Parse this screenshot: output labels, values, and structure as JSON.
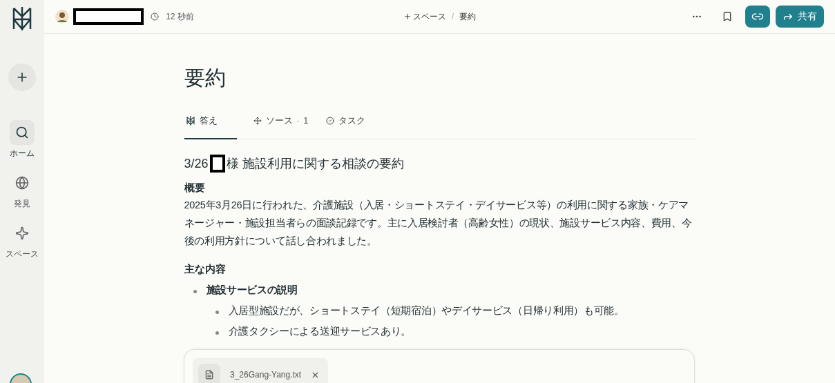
{
  "sidebar": {
    "items": [
      {
        "kind": "home",
        "label": "ホーム",
        "selected": true
      },
      {
        "kind": "discover",
        "label": "発見",
        "selected": false
      },
      {
        "kind": "spaces",
        "label": "スペース",
        "selected": false
      }
    ]
  },
  "topbar": {
    "time": "12 秒前",
    "space": "スペース",
    "separator": "/",
    "page": "要約",
    "share": "共有"
  },
  "page": {
    "title": "要約",
    "tabs": [
      {
        "kind": "answer",
        "label": "答え",
        "selected": true
      },
      {
        "kind": "sources",
        "label": "ソース",
        "separator": "·",
        "count": "1",
        "selected": false
      },
      {
        "kind": "tasks",
        "label": "タスク",
        "selected": false
      }
    ],
    "heading_before": "3/26",
    "heading_after": "様 施設利用に関する相談の要約",
    "sections": [
      {
        "title": "概要",
        "paragraph": "2025年3月26日に行われた、介護施設（入居・ショートステイ・デイサービス等）の利用に関する家族・ケアマネージャー・施設担当者らの面談記録です。主に入居検討者（高齢女性）の現状、施設サービス内容、費用、今後の利用方針について話し合われました。"
      },
      {
        "title": "主な内容",
        "items": [
          {
            "text": "施設サービスの説明",
            "children": [
              {
                "text": "入居型施設だが、ショートステイ（短期宿泊）やデイサービス（日帰り利用）も可能。"
              },
              {
                "text": "介護タクシーによる送迎サービスあり。"
              }
            ]
          }
        ]
      }
    ]
  },
  "composer": {
    "attachment": "3_26Gang-Yang.txt"
  }
}
